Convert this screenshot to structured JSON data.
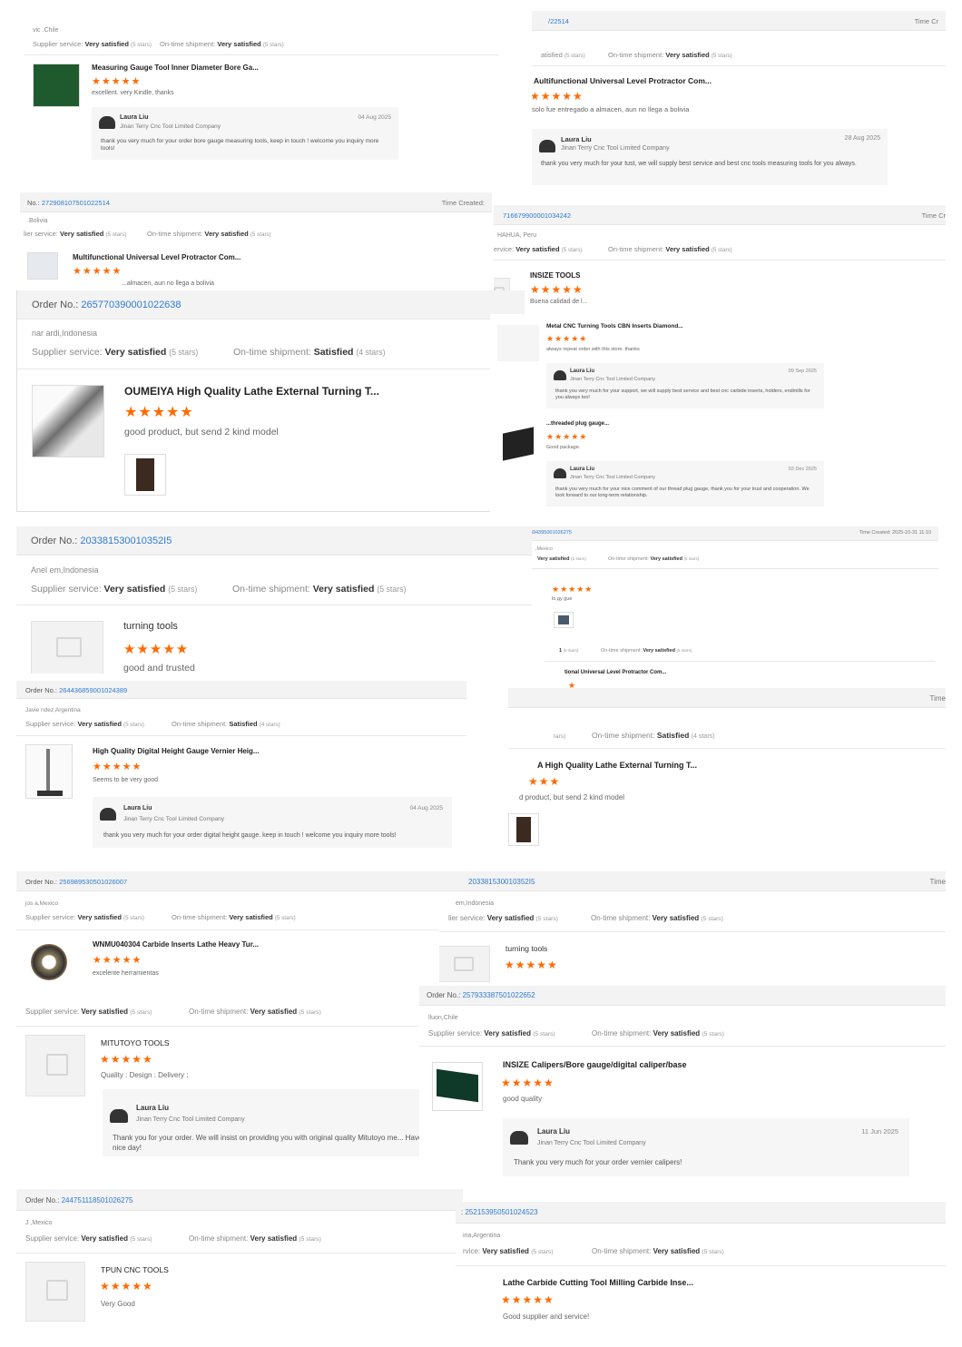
{
  "cards": {
    "c1": {
      "buyer": "vic          .Chile",
      "supplier_label": "Supplier service:",
      "supplier_val": "Very satisfied",
      "supplier_stars": "(5 stars)",
      "ontime_label": "On-time shipment:",
      "ontime_val": "Very satisfied",
      "ontime_stars": "(5 stars)",
      "product": "Measuring Gauge Tool Inner Diameter Bore Ga...",
      "stars": "★★★★★",
      "comment": "excellent. very Kindle, thanks",
      "reply_name": "Laura Liu",
      "reply_company": "Jinan Terry Cnc Tool Limited Company",
      "reply_date": "04 Aug 2025",
      "reply_text": "thank you very much for your order bore gauge measuring tools, keep in touch ! welcome you inquiry more tools!"
    },
    "c2": {
      "order_label": "No.:",
      "order_no": "272908107501022514",
      "time_label": "Time Created:",
      "buyer": "          .Bolivia",
      "supplier_label": "lier service:",
      "supplier_val": "Very satisfied",
      "supplier_stars": "(5 stars)",
      "ontime_label": "On-time shipment:",
      "ontime_val": "Very satisfied",
      "ontime_stars": "(5 stars)",
      "product": "Multifunctional Universal Level Protractor Com...",
      "stars": "★★★★★",
      "comment": "...almacen, aun no llega a bolivia"
    },
    "c3": {
      "order_no": "/22514",
      "time_label": "Time Cr",
      "supplier_label": "atisfied",
      "supplier_stars": "(5 stars)",
      "ontime_label": "On-time shipment:",
      "ontime_val": "Very satisfied",
      "ontime_stars": "(5 stars)",
      "product": "Aultifunctional Universal Level Protractor Com...",
      "stars": "★★★★★",
      "comment": "solo fue entregado a almacen, aun no llega a bolivia",
      "reply_name": "Laura Liu",
      "reply_company": "Jinan Terry Cnc Tool Limited Company",
      "reply_date": "28 Aug 2025",
      "reply_text": "thank you very much for your tust, we will supply best service and best cnc tools measuring tools for you always."
    },
    "c4": {
      "order_no": "716679900001034242",
      "time_label": "Time Cr",
      "buyer": "          HAHUA, Peru",
      "supplier_label": "ervice:",
      "supplier_val": "Very satisfied",
      "supplier_stars": "(5 stars)",
      "ontime_label": "On-time shipment:",
      "ontime_val": "Very satisfied",
      "ontime_stars": "(5 stars)",
      "product": "INSIZE TOOLS",
      "stars": "★★★★★",
      "comment": "Buena calidad de l..."
    },
    "c5": {
      "order_label": "Order No.:",
      "order_no": "265770390001022638",
      "buyer": "nar          ardi,Indonesia",
      "supplier_label": "Supplier service:",
      "supplier_val": "Very satisfied",
      "supplier_stars": "(5 stars)",
      "ontime_label": "On-time shipment:",
      "ontime_val": "Satisfied",
      "ontime_stars": "(4 stars)",
      "product": "OUMEIYA High Quality Lathe External Turning T...",
      "stars": "★★★★★",
      "comment": "good product, but send 2 kind model"
    },
    "c6": {
      "p1_product": "Metal CNC Turning Tools CBN Inserts Diamond...",
      "p1_stars": "★★★★★",
      "p1_comment": "always repeat order with this store. thanks",
      "p1_reply_name": "Laura Liu",
      "p1_reply_company": "Jinan Terry Cnc Tool Limited Company",
      "p1_reply_date": "09 Sep 2025",
      "p1_reply_text": "thank you very much for your support, we will supply best service and best cnc carbide inserts, holders, endmills for you always too!",
      "p2_product": "...threaded plug gauge...",
      "p2_stars": "★★★★★",
      "p2_comment": "Good package.",
      "p2_reply_name": "Laura Liu",
      "p2_reply_company": "Jinan Terry Cnc Tool Limited Company",
      "p2_reply_date": "03 Dec 2025",
      "p2_reply_text": "thank you very much for your nice comment of our thread plug gauge, thank you for your trust and cooperation. We look forward to our long-term relationship."
    },
    "c7": {
      "order_no": "594395001026275",
      "time_label": "Time Created: 2025-10-31 11:10",
      "buyer": "         ,Mexico",
      "supplier_val": "Very satisfied",
      "supplier_stars": "(5 stars)",
      "ontime_label": "On-time shipment:",
      "ontime_val": "Very satisfied",
      "ontime_stars": "(5 stars)",
      "stars": "★★★★★",
      "comment": "lo ду gue"
    },
    "c8": {
      "supplier_label": "1",
      "supplier_stars": "(5 stars)",
      "ontime_label": "On-time shipment:",
      "ontime_val": "Very satisfied",
      "ontime_stars": "(5 stars)",
      "product": "tional Universal Level Protractor Com...",
      "stars": "★"
    },
    "c9": {
      "order_label": "Order No.:",
      "order_no": "203381530010352I5",
      "buyer": "Anel          em,Indonesia",
      "supplier_label": "Supplier service:",
      "supplier_val": "Very satisfied",
      "supplier_stars": "(5 stars)",
      "ontime_label": "On-time shipment:",
      "ontime_val": "Very satisfied",
      "ontime_stars": "(5 stars)",
      "product": "turning tools",
      "stars": "★★★★★",
      "comment": "good and trusted"
    },
    "c10": {
      "time_label": "Time",
      "supplier_label": "tars)",
      "ontime_label": "On-time shipment:",
      "ontime_val": "Satisfied",
      "ontime_stars": "(4 stars)",
      "product": "A High Quality Lathe External Turning T...",
      "stars": "★★★",
      "comment": "d product, but send 2 kind model"
    },
    "c11": {
      "order_label": "Order No.:",
      "order_no": "264436859001024389",
      "buyer": "Javie          ndez,Argentina",
      "supplier_label": "Supplier service:",
      "supplier_val": "Very satisfied",
      "supplier_stars": "(5 stars)",
      "ontime_label": "On-time shipment:",
      "ontime_val": "Satisfied",
      "ontime_stars": "(4 stars)",
      "product": "High Quality Digital Height Gauge Vernier Heig...",
      "stars": "★★★★★",
      "comment": "Seems to be very good",
      "reply_name": "Laura Liu",
      "reply_company": "Jinan Terry Cnc Tool Limited Company",
      "reply_date": "04 Aug 2025",
      "reply_text": "thank you very much for your order digital height gauge.  keep in touch ! welcome you inquiry more tools!"
    },
    "c12": {
      "order_label": "Order No.:",
      "order_no": "256989530501026007",
      "buyer": "jos          a,Mexico",
      "supplier_label": "Supplier service:",
      "supplier_val": "Very satisfied",
      "supplier_stars": "(5 stars)",
      "ontime_label": "On-time shipment:",
      "ontime_val": "Very satisfied",
      "ontime_stars": "(5 stars)",
      "product": "WNMU040304 Carbide Inserts Lathe Heavy Tur...",
      "stars": "★★★★★",
      "comment": "excelente herramientas"
    },
    "c13": {
      "order_no": "203381530010352I5",
      "time_label": "Time",
      "buyer": "          em,Indonesia",
      "supplier_label": "lier service:",
      "supplier_val": "Very satisfied",
      "supplier_stars": "(5 stars)",
      "ontime_label": "On-time shipment:",
      "ontime_val": "Very satisfied",
      "ontime_stars": "(5 stars)",
      "product": "turning tools",
      "stars": "★★★★★"
    },
    "c14": {
      "supplier_label": "Supplier service:",
      "supplier_val": "Very satisfied",
      "supplier_stars": "(5 stars)",
      "ontime_label": "On-time shipment:",
      "ontime_val": "Very satisfied",
      "ontime_stars": "(5 stars)",
      "product": "MITUTOYO TOOLS",
      "stars": "★★★★★",
      "comment": "Quality :    Design :    Delivery :",
      "reply_name": "Laura Liu",
      "reply_company": "Jinan Terry Cnc Tool Limited Company",
      "reply_text": "Thank you for your order. We will insist on providing you with original quality Mitutoyo me... Have a nice day!"
    },
    "c15": {
      "order_label": "Order No.:",
      "order_no": "257933387501022652",
      "buyer": "          lluon,Chile",
      "supplier_label": "Supplier service:",
      "supplier_val": "Very satisfied",
      "supplier_stars": "(5 stars)",
      "ontime_label": "On-time shipment:",
      "ontime_val": "Very satisfied",
      "ontime_stars": "(5 stars)",
      "product": "INSIZE Calipers/Bore gauge/digital caliper/base",
      "stars": "★★★★★",
      "comment": "good quality",
      "reply_name": "Laura Liu",
      "reply_company": "Jinan Terry Cnc Tool Limited Company",
      "reply_date": "11 Jun 2025",
      "reply_text": "Thank you very much for your order vernier calipers!"
    },
    "c16": {
      "order_label": "Order No.:",
      "order_no": "244751118501026275",
      "buyer": "J          ,Mexico",
      "supplier_label": "Supplier service:",
      "supplier_val": "Very satisfied",
      "supplier_stars": "(5 stars)",
      "ontime_label": "On-time shipment:",
      "ontime_val": "Very satisfied",
      "ontime_stars": "(5 stars)",
      "product": "TPUN CNC TOOLS",
      "stars": "★★★★★",
      "comment": "Very Good"
    },
    "c17": {
      "order_label": ":",
      "order_no": "252153950501024523",
      "buyer": "          ina,Argentina",
      "supplier_label": "rvice:",
      "supplier_val": "Very satisfied",
      "supplier_stars": "(5 stars)",
      "ontime_label": "On-time shipment:",
      "ontime_val": "Very satisfied",
      "ontime_stars": "(5 stars)",
      "product": "Lathe Carbide Cutting Tool Milling Carbide Inse...",
      "stars": "★★★★★",
      "comment": "Good supplier and service!"
    }
  }
}
